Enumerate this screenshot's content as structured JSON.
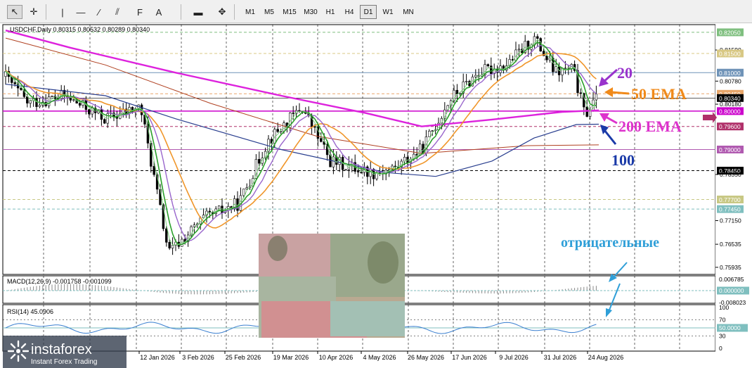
{
  "toolbar": {
    "tools": [
      {
        "name": "cursor",
        "icon": "cursor-arrow-icon",
        "glyph": "↖"
      },
      {
        "name": "crosshair",
        "icon": "crosshair-icon",
        "glyph": "✛"
      },
      {
        "name": "vertical-line",
        "icon": "vertical-line-icon",
        "glyph": "|"
      },
      {
        "name": "horizontal-line",
        "icon": "horizontal-line-icon",
        "glyph": "—"
      },
      {
        "name": "trendline",
        "icon": "trendline-icon",
        "glyph": "∕"
      },
      {
        "name": "channel",
        "icon": "equidistant-channel-icon",
        "glyph": "⫽"
      },
      {
        "name": "fibonacci",
        "icon": "fibonacci-icon",
        "glyph": "F"
      },
      {
        "name": "text",
        "icon": "text-tool-icon",
        "glyph": "A"
      },
      {
        "name": "label",
        "icon": "label-tool-icon",
        "glyph": "▬"
      },
      {
        "name": "shapes",
        "icon": "shapes-dropdown-icon",
        "glyph": "✥"
      }
    ],
    "timeframes": [
      "M1",
      "M5",
      "M15",
      "M30",
      "H1",
      "H4",
      "D1",
      "W1",
      "MN"
    ],
    "active_timeframe": "D1"
  },
  "chart_data": {
    "type": "candlestick",
    "title": "USDCHF,Daily 0.80315 0.80532 0.80289 0.80340",
    "price_ticks": [
      "0.82050",
      "0.81590",
      "0.81500",
      "0.81000",
      "0.80780",
      "0.80450",
      "0.80340",
      "0.80180",
      "0.80000",
      "0.79600",
      "0.79000",
      "0.78450",
      "0.78350",
      "0.77700",
      "0.77450",
      "0.77150",
      "0.76535",
      "0.75935"
    ],
    "highlighted_levels": [
      {
        "value": "0.82050",
        "color": "#7fbf7f",
        "style": "dashed"
      },
      {
        "value": "0.81500",
        "color": "#d8c884",
        "style": "dashed"
      },
      {
        "value": "0.81000",
        "color": "#6f93b8",
        "style": "solid"
      },
      {
        "value": "0.80450",
        "color": "#e8a66a",
        "style": "dashed"
      },
      {
        "value": "0.80340",
        "color": "#000000",
        "style": "current"
      },
      {
        "value": "0.80000",
        "color": "#cc00cc",
        "style": "solid"
      },
      {
        "value": "0.79600",
        "color": "#b0306a",
        "style": "dashed"
      },
      {
        "value": "0.79000",
        "color": "#b05ab0",
        "style": "solid"
      },
      {
        "value": "0.78450",
        "color": "#000000",
        "style": "dashed"
      },
      {
        "value": "0.77700",
        "color": "#c8c884",
        "style": "dashed"
      },
      {
        "value": "0.77450",
        "color": "#7fbfbf",
        "style": "dashed"
      }
    ],
    "x_labels": [
      "12 Jan 2026",
      "3 Feb 2026",
      "25 Feb 2026",
      "19 Mar 2026",
      "10 Apr 2026",
      "4 May 2026",
      "26 May 2026",
      "17 Jun 2026",
      "9 Jul 2026",
      "31 Jul 2026",
      "24 Aug 2026"
    ],
    "annotations": [
      {
        "text": "20",
        "color": "#9933cc"
      },
      {
        "text": "50 EMA",
        "color": "#f08a1a"
      },
      {
        "text": "200 EMA",
        "color": "#dd33cc"
      },
      {
        "text": "100",
        "color": "#1a3aa8"
      },
      {
        "text": "отрицательные",
        "color": "#2f9fd8"
      }
    ],
    "macd": {
      "label": "MACD(12,26,9) -0.001758 -0.001099",
      "ticks": [
        "0.006785",
        "0.000000",
        "-0.008023"
      ]
    },
    "rsi": {
      "label": "RSI(14) 45.0906",
      "ticks": [
        "100",
        "70",
        "50.0000",
        "30",
        "0"
      ]
    },
    "ylim": [
      0.7575,
      0.8225
    ],
    "series_colors": {
      "ma20": "#9966cc",
      "ema50": "#f0962a",
      "ma100": "#2a3f8f",
      "ema200": "#dd22dd",
      "dark_ma": "#b04020",
      "green_ma": "#2aa02a",
      "light_green": "#7ed07e"
    }
  },
  "watermark": {
    "brand": "instaforex",
    "tagline": "Instant Forex Trading"
  }
}
